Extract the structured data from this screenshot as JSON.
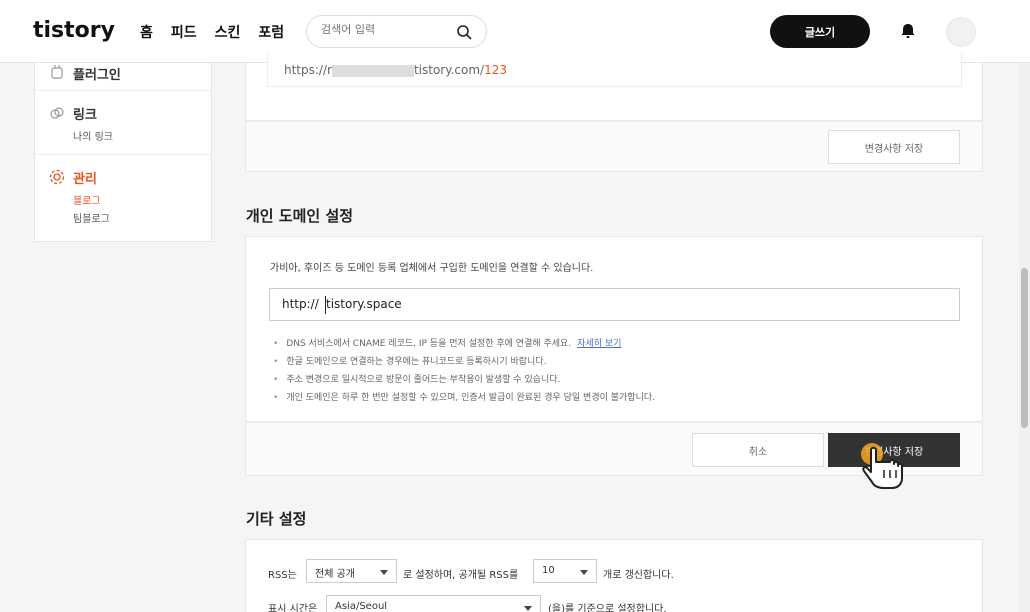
{
  "header": {
    "logo": "tistory",
    "nav": [
      "홈",
      "피드",
      "스킨",
      "포럼"
    ],
    "search_placeholder": "검색어 입력",
    "write_label": "글쓰기"
  },
  "sidebar": {
    "plugin": "플러그인",
    "link_title": "링크",
    "link_sub": "나의 링크",
    "manage_title": "관리",
    "manage_blog": "블로그",
    "manage_teamblog": "팀블로그"
  },
  "top_card": {
    "url_prefix": "https://r",
    "url_suffix": "tistory.com/",
    "url_num": "123",
    "save_label": "변경사항 저장"
  },
  "domain": {
    "title": "개인 도메인 설정",
    "desc": "가비아, 후이즈 등 도메인 등록 업체에서 구입한 도메인을 연결할 수 있습니다.",
    "prefix": "http://",
    "value": "tistory.space",
    "note1": "DNS 서비스에서 CNAME 레코드, IP 등을 먼저 설정한 후에 연결해 주세요.",
    "note1_link": "자세히 보기",
    "note2": "한글 도메인으로 연결하는 경우에는 퓨니코드로 등록하시기 바랍니다.",
    "note3": "주소 변경으로 일시적으로 방문이 줄어드는 부작용이 발생할 수 있습니다.",
    "note4": "개인 도메인은 하루 한 번만 설정할 수 있으며, 인증서 발급이 완료된 경우 당일 변경이 불가합니다.",
    "cancel_label": "취소",
    "save_label": "변경사항 저장"
  },
  "etc": {
    "title": "기타 설정",
    "rss_label": "RSS는",
    "rss_select": "전체 공개",
    "rss_mid": "로 설정하며, 공개될 RSS를",
    "rss_count": "10",
    "rss_end": "개로 갱신합니다.",
    "time_label": "표시 시간은",
    "time_select": "Asia/Seoul",
    "time_end": "(을)를 기준으로 설정합니다."
  },
  "colors": {
    "accent": "#eb531f",
    "dark": "#111111"
  }
}
